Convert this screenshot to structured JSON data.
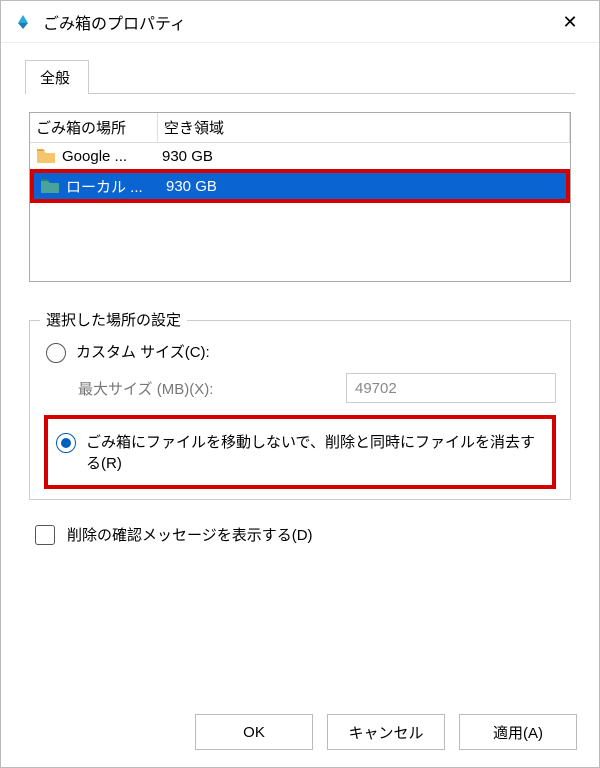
{
  "window": {
    "title": "ごみ箱のプロパティ",
    "close_glyph": "✕"
  },
  "tab": {
    "general": "全般"
  },
  "list": {
    "header_location": "ごみ箱の場所",
    "header_free": "空き領域",
    "rows": [
      {
        "name": "Google  ...",
        "free": "930 GB",
        "selected": false,
        "icon": "folder-yellow"
      },
      {
        "name": "ローカル ...",
        "free": "930 GB",
        "selected": true,
        "icon": "folder-teal"
      }
    ]
  },
  "settings": {
    "group_title": "選択した場所の設定",
    "custom_size_label": "カスタム サイズ(C):",
    "max_size_label": "最大サイズ (MB)(X):",
    "max_size_value": "49702",
    "no_recycle_label": "ごみ箱にファイルを移動しないで、削除と同時にファイルを消去する(R)"
  },
  "confirm_delete_label": "削除の確認メッセージを表示する(D)",
  "buttons": {
    "ok": "OK",
    "cancel": "キャンセル",
    "apply": "適用(A)"
  }
}
